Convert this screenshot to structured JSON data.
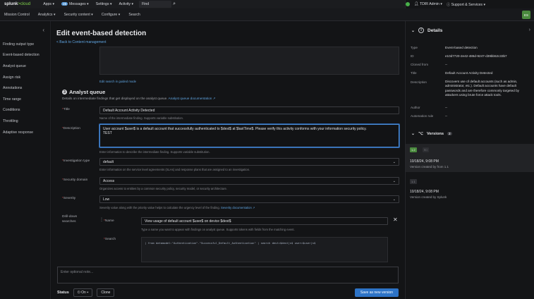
{
  "topbar": {
    "logo_main": "splunk",
    "logo_accent": ">cloud",
    "apps": "Apps ▾",
    "messages_count": "26",
    "messages": "Messages ▾",
    "settings": "Settings ▾",
    "activity": "Activity ▾",
    "find": "Find",
    "user": "TDIR Admin ▾",
    "support": "Support & Services ▾"
  },
  "nav": {
    "items": [
      "Mission Control",
      "Analytics ▾",
      "Security content ▾",
      "Configure ▾",
      "Search"
    ],
    "app_icon": "ES"
  },
  "sidebar": {
    "items": [
      "Finding output type",
      "Event-based detection",
      "Analyst queue",
      "Assign risk",
      "Annotations",
      "Time range",
      "Conditions",
      "Throttling",
      "Adaptive response"
    ]
  },
  "main": {
    "title": "Edit event-based detection",
    "back_link": "< Back to Content management",
    "edit_search_link": "Edit search in guided mode",
    "section_number": "3",
    "section_title": "Analyst queue",
    "section_desc": "Details on intermediate findings that get displayed on the analyst queue.",
    "section_doc_link": "Analyst queue documentation ↗",
    "title_label": "Title",
    "title_value": "Default Account Activity Detected",
    "title_help": "Name of the intermediate finding. Supports variable substitution.",
    "desc_label": "Description",
    "desc_value": "User account $user$ is a default account that successfully authenticated to $dest$ at $lastTime$. Please verify this activity conforms with your information security policy.",
    "desc_value2": "TEST",
    "desc_help": "Enter information to describe the intermediate finding. Supports variable substitution.",
    "inv_label": "Investigation type",
    "inv_value": "default",
    "inv_help": "Enter information on the service level agreements (SLAs) and response plans that are assigned to an investigation.",
    "domain_label": "Security domain",
    "domain_value": "Access",
    "domain_help": "Organizes access to entities by a common security policy, security model, or security architecture.",
    "severity_label": "Severity",
    "severity_value": "Low",
    "severity_help": "Severity value along with the priority value helps to calculate the urgency level of the finding.",
    "severity_doc_link": "Severity documentation ↗",
    "drill_label": "Drill-down searches",
    "name_label": "Name",
    "name_value": "View usage of default account $user$ on device $dest$",
    "name_help": "Type a name you want to appear with findings on analyst queue. Supports tokens with fields from the matching event.",
    "search_label": "Search",
    "search_value": "| from datamodel:\"Authentication\".\"Successful_Default_Authentication\" | search dest=$dest|s$ user=$user|s$",
    "optional_note_placeholder": "Enter optional note...",
    "status_label": "Status",
    "status_value": "On",
    "clone_label": "Clone",
    "save_label": "Save as new version"
  },
  "details": {
    "title": "Details",
    "rows": [
      {
        "k": "Type",
        "v": "Event-based detection"
      },
      {
        "k": "ID",
        "v": "e10d7720-2e42-486d-9247-d39bb52c33b7"
      },
      {
        "k": "Cloned from",
        "v": "--"
      },
      {
        "k": "Title",
        "v": "Default Account Activity Detected"
      },
      {
        "k": "Description",
        "v": "Discovers use of default accounts (such as admin, administrator, etc.). Default accounts have default passwords and are therefore commonly targeted by attackers using brute force attack tools."
      },
      {
        "k": "Author",
        "v": "--"
      },
      {
        "k": "Automation rule",
        "v": "--"
      }
    ],
    "versions_title": "Versions",
    "versions_count": "2",
    "versions": [
      {
        "tag": "1.2",
        "date": "10/18/24, 9:08 PM",
        "sub": "Version created by from 1.1"
      },
      {
        "tag": "1.1",
        "date": "10/18/24, 9:08 PM",
        "sub": "Version created by Splunk"
      }
    ]
  }
}
